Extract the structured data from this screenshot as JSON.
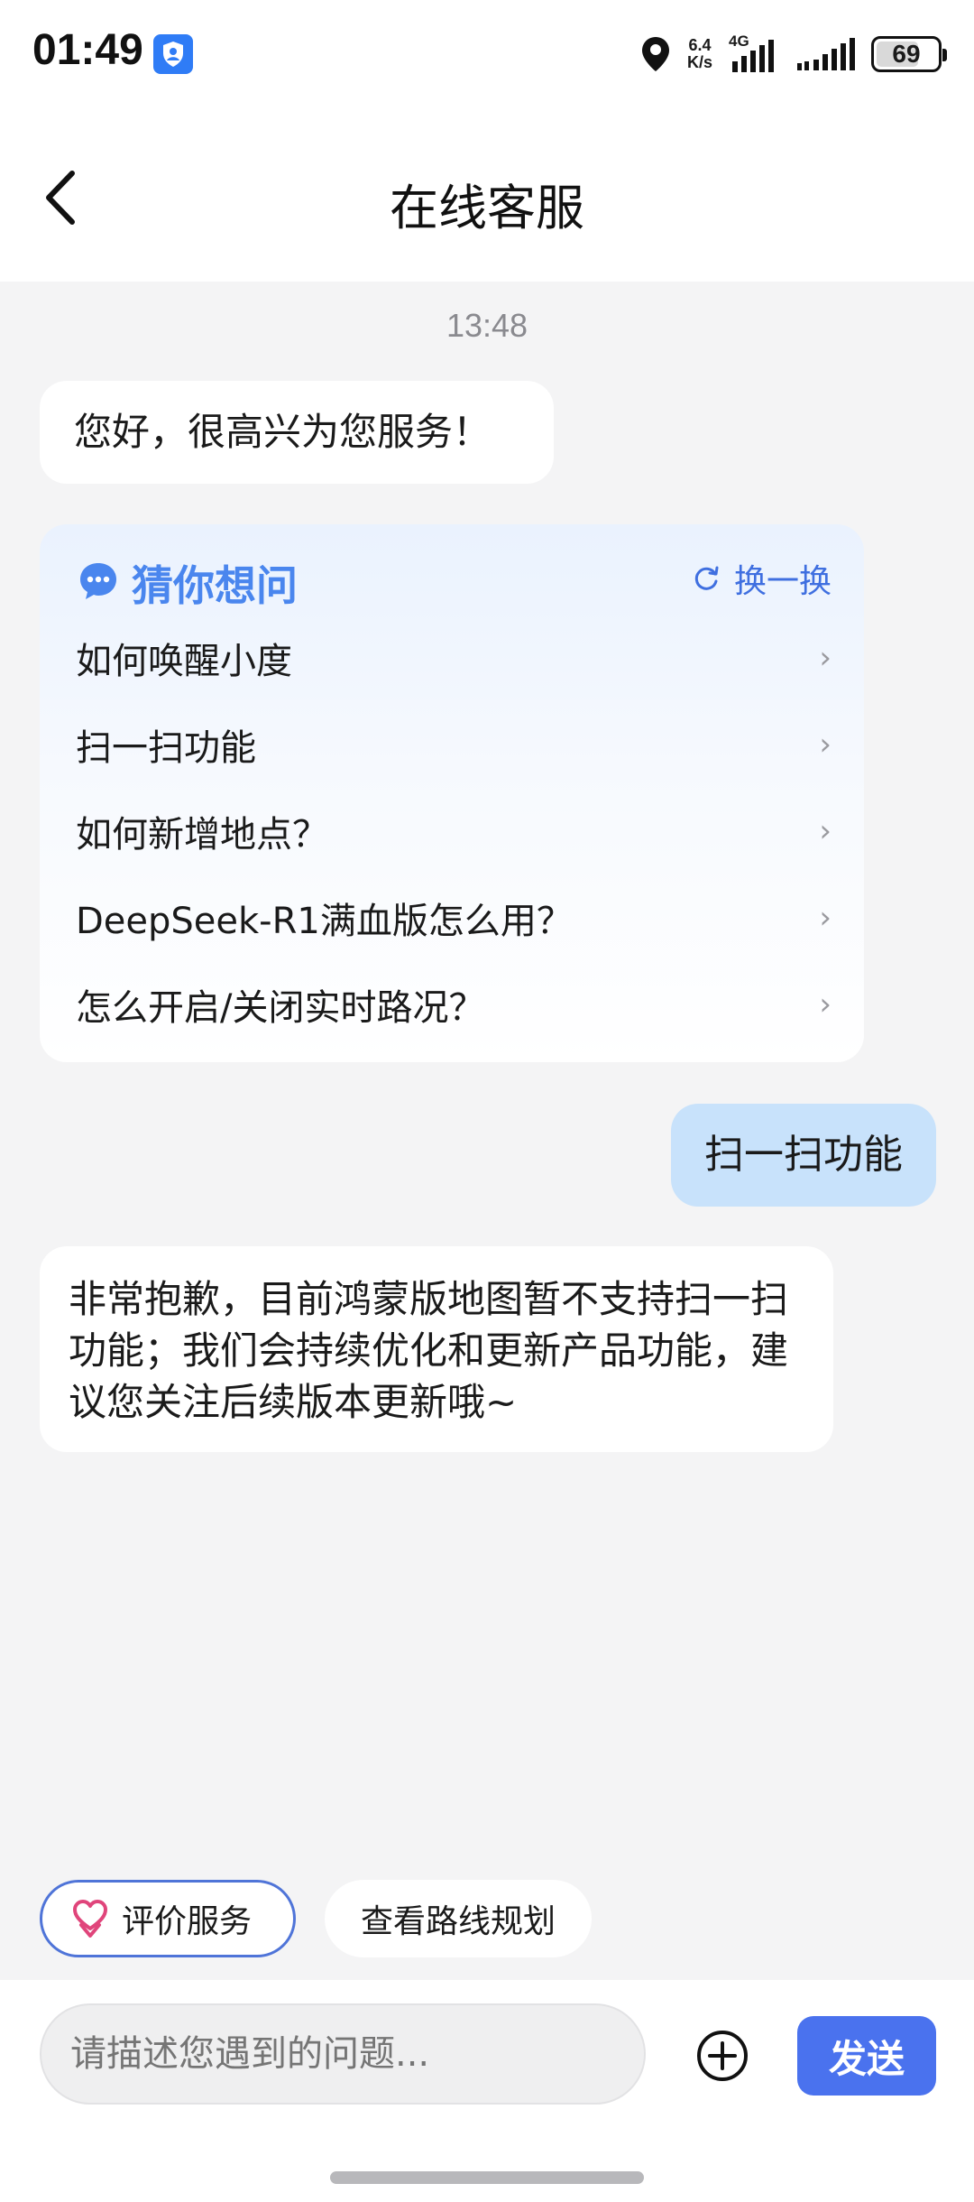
{
  "status_bar": {
    "time": "01:49",
    "net_speed_value": "6.4",
    "net_speed_unit": "K/s",
    "network_type": "4G",
    "battery": "69",
    "battery_level": 0.69
  },
  "header": {
    "title": "在线客服"
  },
  "chat": {
    "timestamp": "13:48",
    "greeting": "您好，很高兴为您服务！",
    "suggestions": {
      "title": "猜你想问",
      "refresh_label": "换一换",
      "items": [
        "如何唤醒小度",
        "扫一扫功能",
        "如何新增地点？",
        "DeepSeek-R1满血版怎么用？",
        "怎么开启/关闭实时路况？"
      ]
    },
    "user_message": "扫一扫功能",
    "reply": "非常抱歉，目前鸿蒙版地图暂不支持扫一扫功能；我们会持续优化和更新产品功能，建议您关注后续版本更新哦~"
  },
  "quick_actions": {
    "rate_label": "评价服务",
    "route_label": "查看路线规划"
  },
  "input": {
    "placeholder": "请描述您遇到的问题...",
    "send_label": "发送"
  },
  "colors": {
    "accent": "#4a72ee",
    "user_bubble": "#c8e2fb",
    "card_title": "#4a86ee",
    "background": "#f4f4f5"
  }
}
